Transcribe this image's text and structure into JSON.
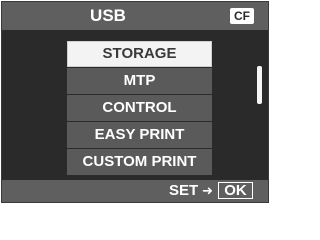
{
  "header": {
    "title": "USB",
    "card_badge": "CF"
  },
  "menu": {
    "items": [
      {
        "label": "STORAGE",
        "selected": true
      },
      {
        "label": "MTP",
        "selected": false
      },
      {
        "label": "CONTROL",
        "selected": false
      },
      {
        "label": "EASY PRINT",
        "selected": false
      },
      {
        "label": "CUSTOM PRINT",
        "selected": false
      }
    ]
  },
  "footer": {
    "set_label": "SET",
    "arrow_icon": "arrow-right-icon",
    "ok_label": "OK"
  },
  "colors": {
    "background": "#2a2a2a",
    "bar": "#5f5f5f",
    "menu_item": "#5a5a5a",
    "selected_item": "#f3f3f3",
    "text": "#ffffff"
  }
}
